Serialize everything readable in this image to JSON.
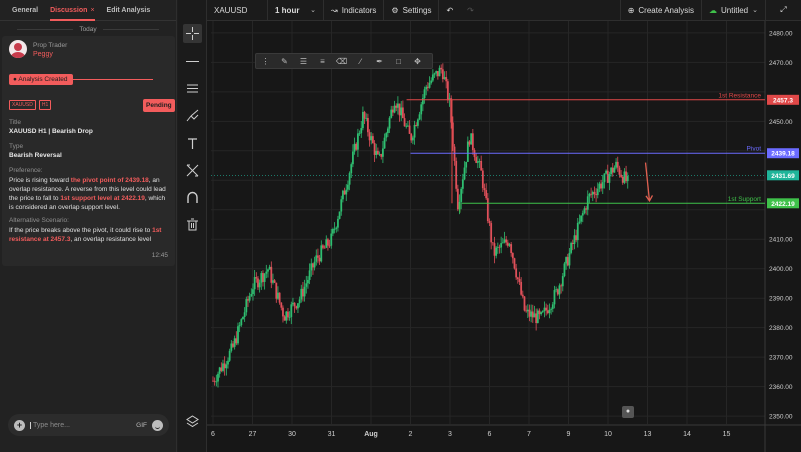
{
  "panel": {
    "tabs": [
      {
        "label": "General"
      },
      {
        "label": "Discussion",
        "close": "×"
      },
      {
        "label": "Edit Analysis"
      }
    ],
    "date_separator": "Today",
    "sender": {
      "role": "Prop Trader",
      "name": "Peggy"
    },
    "event": "Analysis Created",
    "badges": [
      "XAUUSD",
      "H1"
    ],
    "status": "Pending",
    "title_label": "Title",
    "title_value": "XAUUSD H1 | Bearish Drop",
    "type_label": "Type",
    "type_value": "Bearish Reversal",
    "preference_label": "Preference:",
    "preference_parts": [
      {
        "t": "Price is rising toward ",
        "hl": false
      },
      {
        "t": "the pivot point of 2439.18",
        "hl": true
      },
      {
        "t": ", an overlap resistance. A reverse from this level could lead the price to fall to ",
        "hl": false
      },
      {
        "t": "1st support level at 2422.19",
        "hl": true
      },
      {
        "t": ", which is considered an overlap support level.",
        "hl": false
      }
    ],
    "alt_label": "Alternative Scenario:",
    "alt_parts": [
      {
        "t": "If the price breaks above the pivot, it could rise to ",
        "hl": false
      },
      {
        "t": "1st resistance at 2457.3",
        "hl": true
      },
      {
        "t": ", an overlap  resistance level",
        "hl": false
      }
    ],
    "time": "12:45",
    "compose_placeholder": "Type here...",
    "gif_label": "GIF"
  },
  "toolbar": {
    "symbol": "XAUUSD",
    "interval": "1 hour",
    "indicators": "Indicators",
    "settings": "Settings",
    "create_analysis": "Create Analysis",
    "layout_name": "Untitled"
  },
  "chart_data": {
    "type": "candlestick",
    "symbol": "XAUUSD",
    "timeframe": "H1",
    "ylim": [
      2348,
      2482
    ],
    "y_ticks": [
      2350,
      2360,
      2370,
      2380,
      2390,
      2400,
      2410,
      2420,
      2430,
      2440,
      2450,
      2460,
      2470,
      2480
    ],
    "x_ticks": [
      {
        "label": "6",
        "x": 0
      },
      {
        "label": "27",
        "x": 1
      },
      {
        "label": "30",
        "x": 2
      },
      {
        "label": "31",
        "x": 3
      },
      {
        "label": "Aug",
        "x": 4
      },
      {
        "label": "2",
        "x": 5
      },
      {
        "label": "3",
        "x": 6
      },
      {
        "label": "6",
        "x": 7
      },
      {
        "label": "7",
        "x": 8
      },
      {
        "label": "9",
        "x": 9
      },
      {
        "label": "10",
        "x": 10
      },
      {
        "label": "13",
        "x": 11
      },
      {
        "label": "14",
        "x": 12
      },
      {
        "label": "15",
        "x": 13
      }
    ],
    "levels": [
      {
        "name": "1st Resistance",
        "value": 2457.3,
        "color": "#e04848"
      },
      {
        "name": "Pivot",
        "value": 2439.18,
        "color": "#6b6bff"
      },
      {
        "name": "1st Support",
        "value": 2422.19,
        "color": "#3fc24a"
      }
    ],
    "last_price": {
      "value": 2431.69,
      "color": "#1fb59a"
    },
    "close_anchors": [
      [
        0,
        2362
      ],
      [
        0.5,
        2373
      ],
      [
        1,
        2394
      ],
      [
        1.4,
        2400
      ],
      [
        1.8,
        2384
      ],
      [
        2.2,
        2390
      ],
      [
        2.6,
        2403
      ],
      [
        3,
        2410
      ],
      [
        3.4,
        2430
      ],
      [
        3.8,
        2452
      ],
      [
        4.2,
        2436
      ],
      [
        4.6,
        2458
      ],
      [
        5,
        2444
      ],
      [
        5.4,
        2462
      ],
      [
        5.8,
        2468
      ],
      [
        6,
        2455
      ],
      [
        6.2,
        2422
      ],
      [
        6.5,
        2445
      ],
      [
        6.8,
        2432
      ],
      [
        7.1,
        2405
      ],
      [
        7.5,
        2410
      ],
      [
        7.9,
        2385
      ],
      [
        8.3,
        2383
      ],
      [
        8.7,
        2392
      ],
      [
        9.1,
        2408
      ],
      [
        9.5,
        2424
      ],
      [
        9.9,
        2430
      ],
      [
        10.2,
        2435
      ],
      [
        10.5,
        2429
      ]
    ],
    "projection": {
      "from": [
        10.95,
        2436
      ],
      "to": [
        11.05,
        2423
      ],
      "color": "#e06050"
    }
  }
}
